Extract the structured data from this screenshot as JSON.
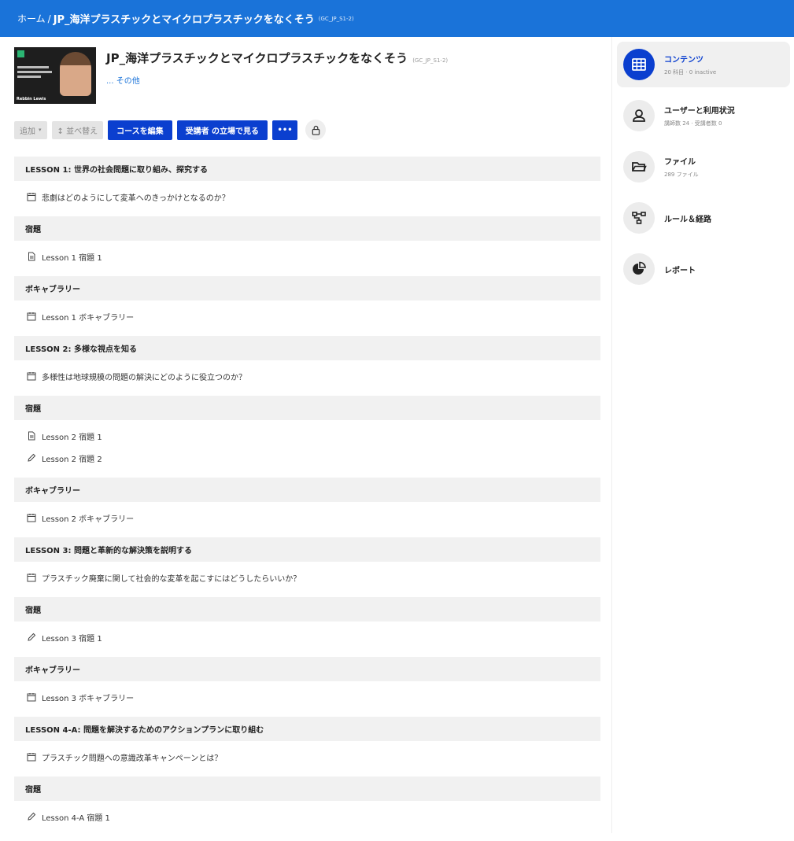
{
  "breadcrumb": {
    "home": "ホーム",
    "separator": "/",
    "title": "JP_海洋プラスチックとマイクロプラスチックをなくそう",
    "code": "(GC_JP_S1-2)"
  },
  "course": {
    "title": "JP_海洋プラスチックとマイクロプラスチックをなくそう",
    "code": "(GC_JP_S1-2)",
    "more": "... その他",
    "thumbnail_name": "Rebbin Lewis"
  },
  "toolbar": {
    "add": "追加",
    "reorder": "↕ 並べ替え",
    "edit": "コースを編集",
    "view_as_learner": "受講者 の立場で見る",
    "more": "•••"
  },
  "content": [
    {
      "type": "section",
      "label": "LESSON 1: 世界の社会問題に取り組み、探究する"
    },
    {
      "type": "item",
      "icon": "calendar-icon",
      "label": "悲劇はどのようにして変革へのきっかけとなるのか？"
    },
    {
      "type": "section",
      "label": "宿題"
    },
    {
      "type": "item",
      "icon": "document-icon",
      "label": "Lesson 1 宿題 1"
    },
    {
      "type": "section",
      "label": "ボキャブラリー"
    },
    {
      "type": "item",
      "icon": "calendar-icon",
      "label": "Lesson 1 ボキャブラリー"
    },
    {
      "type": "section",
      "label": "LESSON 2: 多様な視点を知る"
    },
    {
      "type": "item",
      "icon": "calendar-icon",
      "label": "多様性は地球規模の問題の解決にどのように役立つのか？"
    },
    {
      "type": "section",
      "label": "宿題"
    },
    {
      "type": "item",
      "icon": "document-icon",
      "label": "Lesson 2 宿題 1"
    },
    {
      "type": "item",
      "icon": "pencil-icon",
      "label": "Lesson 2 宿題 2"
    },
    {
      "type": "section",
      "label": "ボキャブラリー"
    },
    {
      "type": "item",
      "icon": "calendar-icon",
      "label": "Lesson 2 ボキャブラリー"
    },
    {
      "type": "section",
      "label": "LESSON 3: 問題と革新的な解決策を説明する"
    },
    {
      "type": "item",
      "icon": "calendar-icon",
      "label": "プラスチック廃棄に関して社会的な変革を起こすにはどうしたらいいか？"
    },
    {
      "type": "section",
      "label": "宿題"
    },
    {
      "type": "item",
      "icon": "pencil-icon",
      "label": "Lesson 3 宿題 1"
    },
    {
      "type": "section",
      "label": "ボキャブラリー"
    },
    {
      "type": "item",
      "icon": "calendar-icon",
      "label": "Lesson 3 ボキャブラリー"
    },
    {
      "type": "section",
      "label": "LESSON 4-A: 問題を解決するためのアクションプランに取り組む"
    },
    {
      "type": "item",
      "icon": "calendar-icon",
      "label": "プラスチック問題への意識改革キャンペーンとは？"
    },
    {
      "type": "section",
      "label": "宿題"
    },
    {
      "type": "item",
      "icon": "pencil-icon",
      "label": "Lesson 4-A 宿題 1"
    }
  ],
  "sidebar": [
    {
      "icon": "grid-icon",
      "title": "コンテンツ",
      "sub": "20 科目 · 0 inactive",
      "active": true
    },
    {
      "icon": "user-icon",
      "title": "ユーザーと利用状況",
      "sub": "講師数 24 · 受講者数 0",
      "active": false
    },
    {
      "icon": "folder-icon",
      "title": "ファイル",
      "sub": "289 ファイル",
      "active": false
    },
    {
      "icon": "route-icon",
      "title": "ルール＆経路",
      "sub": "",
      "active": false
    },
    {
      "icon": "pie-chart-icon",
      "title": "レポート",
      "sub": "",
      "active": false
    }
  ],
  "colors": {
    "primary": "#1a73d9",
    "button": "#0b3fcf"
  }
}
